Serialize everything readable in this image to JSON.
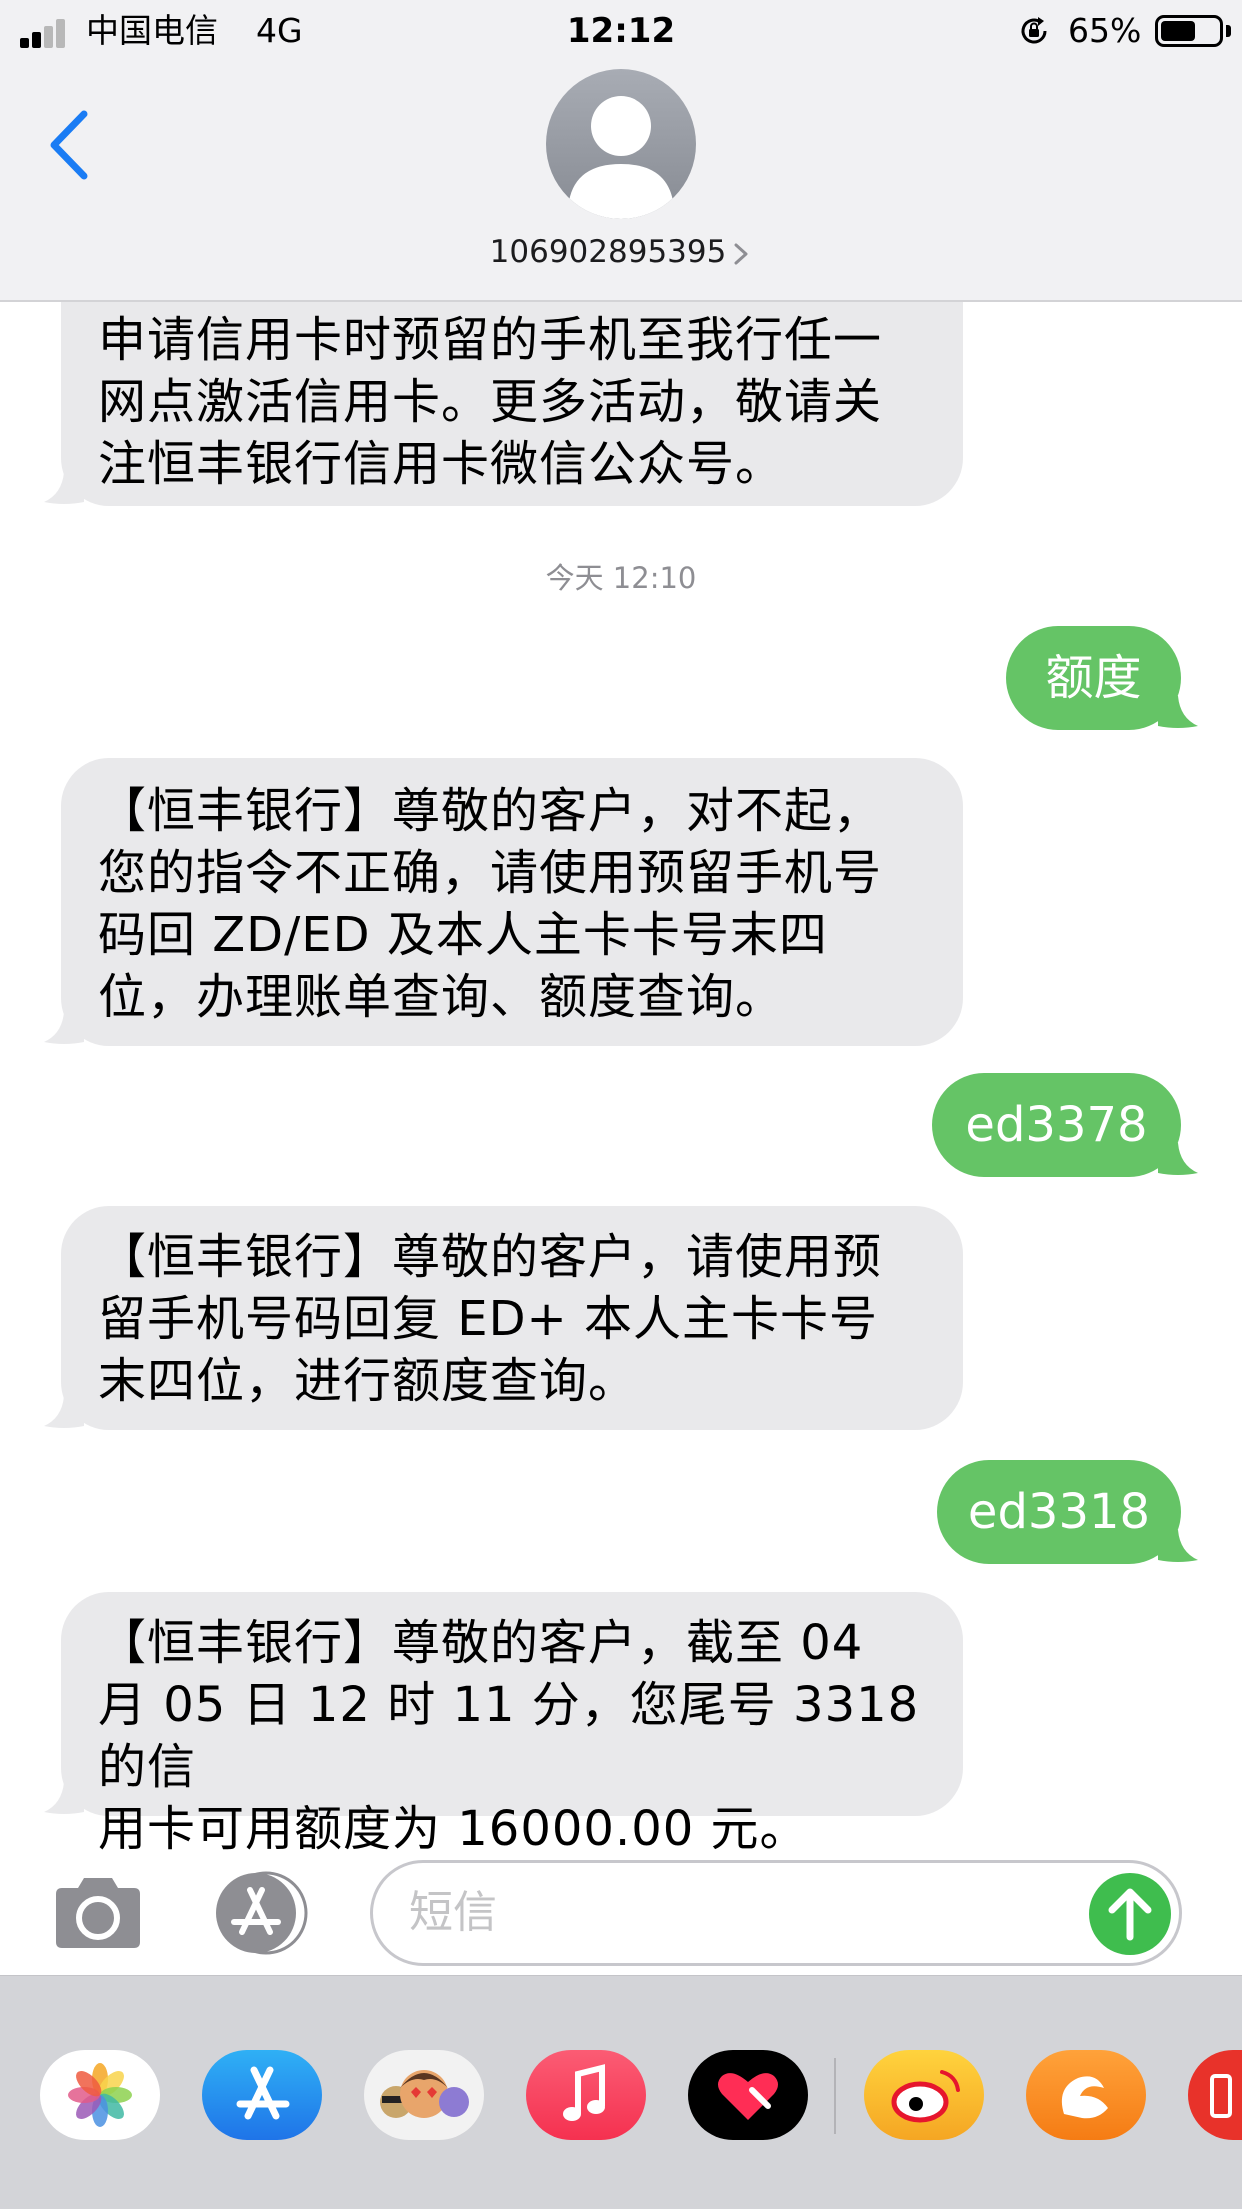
{
  "status_bar": {
    "carrier": "中国电信",
    "network": "4G",
    "time": "12:12",
    "battery_percent": "65%",
    "battery_level": 0.65,
    "signal_bars_active": 2,
    "signal_bars_total": 4
  },
  "header": {
    "contact": "106902895395",
    "back_icon": "chevron-left-icon",
    "avatar_icon": "person-placeholder-icon"
  },
  "messages": [
    {
      "direction": "incoming",
      "text": "申请信用卡时预留的手机至我行任一\n网点激活信用卡。更多活动，敬请关\n注恒丰银行信用卡微信公众号。"
    },
    {
      "direction": "incoming",
      "text": "【恒丰银行】尊敬的客户，对不起，\n您的指令不正确，请使用预留手机号\n码回 ZD/ED 及本人主卡卡号末四\n位，办理账单查询、额度查询。"
    },
    {
      "direction": "outgoing",
      "text": "额度"
    },
    {
      "direction": "outgoing",
      "text": "ed3378"
    },
    {
      "direction": "incoming",
      "text": "【恒丰银行】尊敬的客户，请使用预\n留手机号码回复 ED+ 本人主卡卡号\n末四位，进行额度查询。"
    },
    {
      "direction": "outgoing",
      "text": "ed3318"
    },
    {
      "direction": "incoming",
      "text": "【恒丰银行】尊敬的客户，截至 04\n月 05 日 12 时 11 分，您尾号 3318 的信\n用卡可用额度为 16000.00 元。"
    }
  ],
  "timestamp": "今天 12:10",
  "input": {
    "placeholder": "短信",
    "camera_icon": "camera-icon",
    "apps_icon": "app-store-icon",
    "send_icon": "send-arrow-up-icon"
  },
  "app_drawer": [
    "photos-icon",
    "app-store-icon",
    "memoji-icon",
    "music-icon",
    "digital-touch-icon",
    "weibo-icon",
    "uc-browser-icon",
    "partial-app-icon"
  ],
  "colors": {
    "incoming_bubble": "#e9e9eb",
    "outgoing_bubble": "#65c466",
    "accent_blue": "#1a7cf4",
    "send_green": "#3fbd4e"
  }
}
